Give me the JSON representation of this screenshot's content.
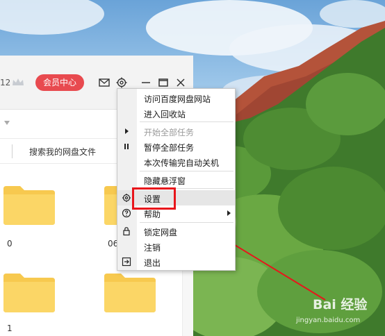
{
  "window": {
    "storage_number": "12",
    "vip_button": "会员中心",
    "search_placeholder": "搜索我的网盘文件"
  },
  "folders": [
    {
      "label": "0"
    },
    {
      "label": "06"
    },
    {
      "label": "1"
    },
    {
      "label": ""
    }
  ],
  "context_menu": {
    "items": [
      {
        "label": "访问百度网盘网站",
        "enabled": true
      },
      {
        "label": "进入回收站",
        "enabled": true
      },
      {
        "label": "开始全部任务",
        "enabled": false,
        "icon": "play-icon"
      },
      {
        "label": "暂停全部任务",
        "enabled": true,
        "icon": "pause-icon"
      },
      {
        "label": "本次传输完自动关机",
        "enabled": true
      },
      {
        "label": "隐藏悬浮窗",
        "enabled": true
      },
      {
        "label": "设置",
        "enabled": true,
        "icon": "gear-icon",
        "highlighted": true
      },
      {
        "label": "帮助",
        "enabled": true,
        "icon": "help-icon",
        "submenu": true
      },
      {
        "label": "锁定网盘",
        "enabled": true,
        "icon": "lock-icon"
      },
      {
        "label": "注销",
        "enabled": true
      },
      {
        "label": "退出",
        "enabled": true,
        "icon": "exit-icon"
      }
    ]
  },
  "watermark": {
    "brand": "Bai 经验",
    "url": "jingyan.baidu.com"
  },
  "colors": {
    "vip_red": "#e84a4f",
    "highlight_red": "#e8151b",
    "folder_yellow": "#f9d465",
    "arrow_red": "#e8151b"
  }
}
